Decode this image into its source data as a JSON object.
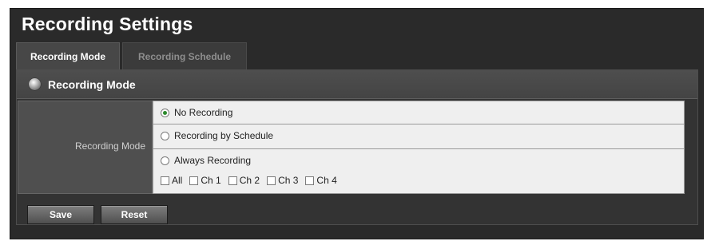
{
  "page": {
    "title": "Recording Settings"
  },
  "tabs": [
    {
      "label": "Recording Mode",
      "active": true
    },
    {
      "label": "Recording Schedule",
      "active": false
    }
  ],
  "section": {
    "title": "Recording Mode",
    "icon": "bullet-icon"
  },
  "setting": {
    "label": "Recording Mode",
    "options": [
      {
        "label": "No Recording",
        "selected": true
      },
      {
        "label": "Recording by Schedule",
        "selected": false
      },
      {
        "label": "Always Recording",
        "selected": false
      }
    ],
    "channels": [
      {
        "label": "All",
        "checked": false
      },
      {
        "label": "Ch 1",
        "checked": false
      },
      {
        "label": "Ch 2",
        "checked": false
      },
      {
        "label": "Ch 3",
        "checked": false
      },
      {
        "label": "Ch 4",
        "checked": false
      }
    ]
  },
  "buttons": {
    "save": "Save",
    "reset": "Reset"
  },
  "colors": {
    "background": "#2a2a2a",
    "panel": "#333333",
    "option_row": "#efefef",
    "selected_radio": "#2c8a2c"
  }
}
